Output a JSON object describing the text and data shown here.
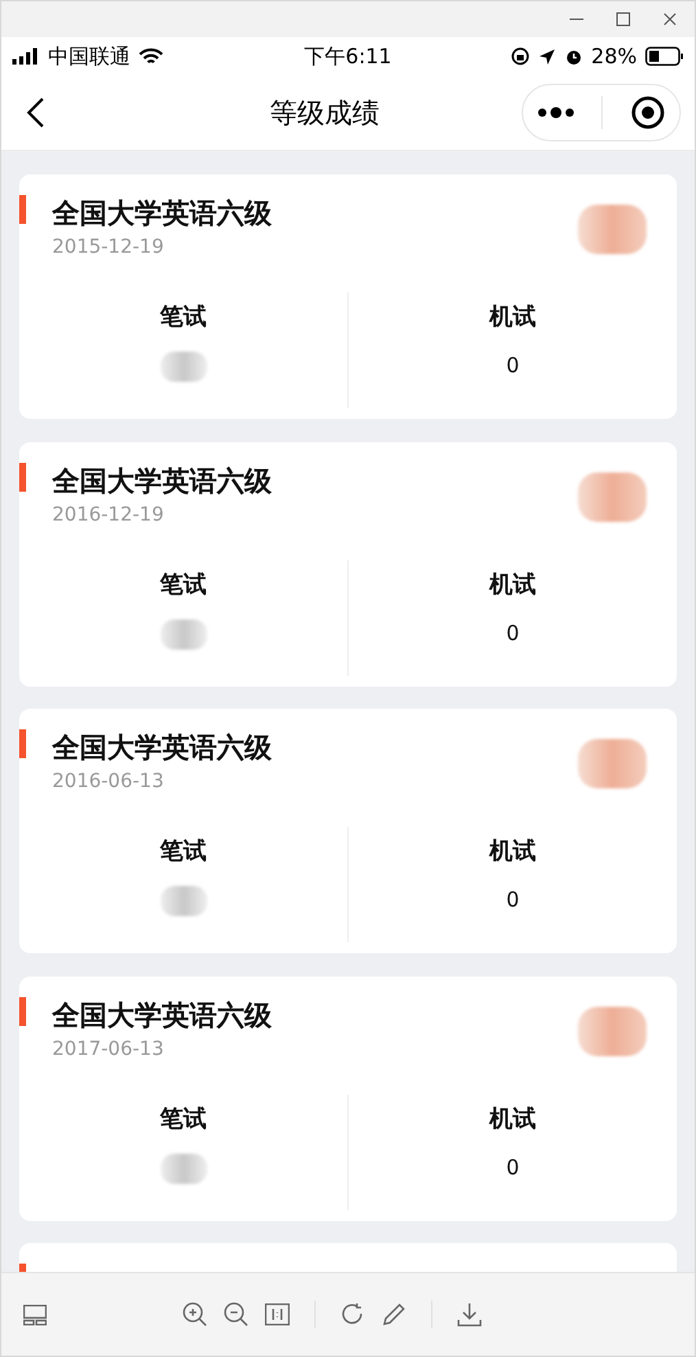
{
  "status_bar": {
    "carrier": "中国联通",
    "time": "下午6:11",
    "battery": "28%"
  },
  "nav": {
    "title": "等级成绩"
  },
  "records": [
    {
      "title": "全国大学英语六级",
      "date": "2015-12-19",
      "written_label": "笔试",
      "machine_label": "机试",
      "machine_score": "0"
    },
    {
      "title": "全国大学英语六级",
      "date": "2016-12-19",
      "written_label": "笔试",
      "machine_label": "机试",
      "machine_score": "0"
    },
    {
      "title": "全国大学英语六级",
      "date": "2016-06-13",
      "written_label": "笔试",
      "machine_label": "机试",
      "machine_score": "0"
    },
    {
      "title": "全国大学英语六级",
      "date": "2017-06-13",
      "written_label": "笔试",
      "machine_label": "机试",
      "machine_score": "0"
    }
  ]
}
